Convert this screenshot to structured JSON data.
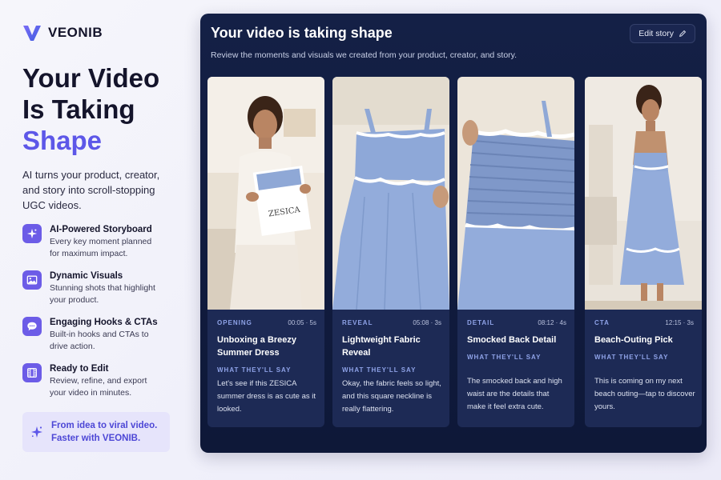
{
  "brand": {
    "name": "VEONIB",
    "logo_icon": "v-logo-icon",
    "accent": "#5d57e8"
  },
  "hero": {
    "line1": "Your Video",
    "line2": "Is Taking",
    "line3": "Shape",
    "lead": "AI turns your product, creator, and story into scroll-stopping UGC videos."
  },
  "features": [
    {
      "icon": "sparkle-icon",
      "title": "AI-Powered Storyboard",
      "desc": "Every key moment planned for maximum impact."
    },
    {
      "icon": "image-icon",
      "title": "Dynamic Visuals",
      "desc": "Stunning shots that highlight your product."
    },
    {
      "icon": "chat-bubble-icon",
      "title": "Engaging Hooks & CTAs",
      "desc": "Built-in hooks and CTAs to drive action."
    },
    {
      "icon": "film-icon",
      "title": "Ready to Edit",
      "desc": "Review, refine, and export your video in minutes."
    }
  ],
  "promo": {
    "icon": "sparkle-icon",
    "line1": "From idea to viral video.",
    "line2": "Faster with VEONIB."
  },
  "panel": {
    "title": "Your video is taking shape",
    "subtitle": "Review the moments and visuals we created from your product, creator, and story.",
    "edit_label": "Edit story",
    "edit_icon": "pencil-icon"
  },
  "cards": [
    {
      "stage": "OPENING",
      "time": "00:05 · 5s",
      "title": "Unboxing a Breezy Summer Dress",
      "say_label": "WHAT THEY'LL SAY",
      "say": "Let's see if this ZESICA summer dress is as cute as it looked.",
      "bag_text": "ZESICA"
    },
    {
      "stage": "REVEAL",
      "time": "05:08 · 3s",
      "title": "Lightweight Fabric Reveal",
      "say_label": "WHAT THEY'LL SAY",
      "say": "Okay, the fabric feels so light, and this square neckline is really flattering."
    },
    {
      "stage": "DETAIL",
      "time": "08:12 · 4s",
      "title": "Smocked Back Detail",
      "say_label": "WHAT THEY'LL SAY",
      "say": "The smocked back and high waist are the details that make it feel extra cute."
    },
    {
      "stage": "CTA",
      "time": "12:15 · 3s",
      "title": "Beach-Outing Pick",
      "say_label": "WHAT THEY'LL SAY",
      "say": "This is coming on my next beach outing—tap to discover yours."
    }
  ]
}
